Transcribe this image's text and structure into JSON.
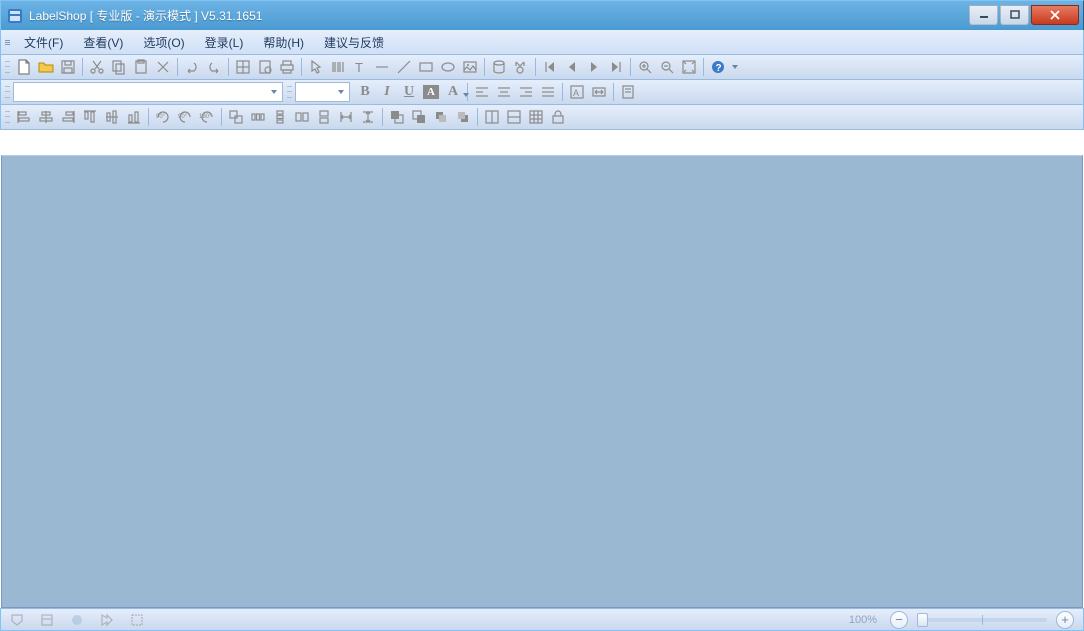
{
  "title": "LabelShop [ 专业版 - 演示模式 ]  V5.31.1651",
  "menu": {
    "file": "文件(F)",
    "view": "查看(V)",
    "options": "选项(O)",
    "login": "登录(L)",
    "help": "帮助(H)",
    "feedback": "建议与反馈"
  },
  "font": {
    "family": "",
    "size": ""
  },
  "status": {
    "zoom": "100%"
  }
}
